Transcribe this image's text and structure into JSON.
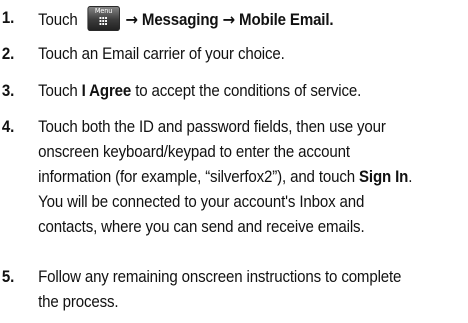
{
  "steps": [
    {
      "number": "1.",
      "touch": "Touch",
      "menu_icon_label": "Menu",
      "arrow": "→",
      "messaging": "Messaging",
      "mobile_email": "Mobile Email",
      "period": "."
    },
    {
      "number": "2.",
      "lines": [
        "Touch an Email carrier of your choice."
      ]
    },
    {
      "number": "3.",
      "before": "Touch ",
      "bold": "I Agree",
      "after": " to accept the conditions of service."
    },
    {
      "number": "4.",
      "line1": "Touch both the ID and password fields, then use your",
      "line2": "onscreen keyboard/keypad to enter the account",
      "line3_before": "information (for example, “silverfox2”), and touch ",
      "line3_bold": "Sign In",
      "line3_after": ".",
      "line4": "You will be connected to your account's Inbox and",
      "line5": "contacts, where you can send and receive emails."
    },
    {
      "number": "5.",
      "line1": "Follow any remaining onscreen instructions to complete",
      "line2": "the process."
    }
  ]
}
